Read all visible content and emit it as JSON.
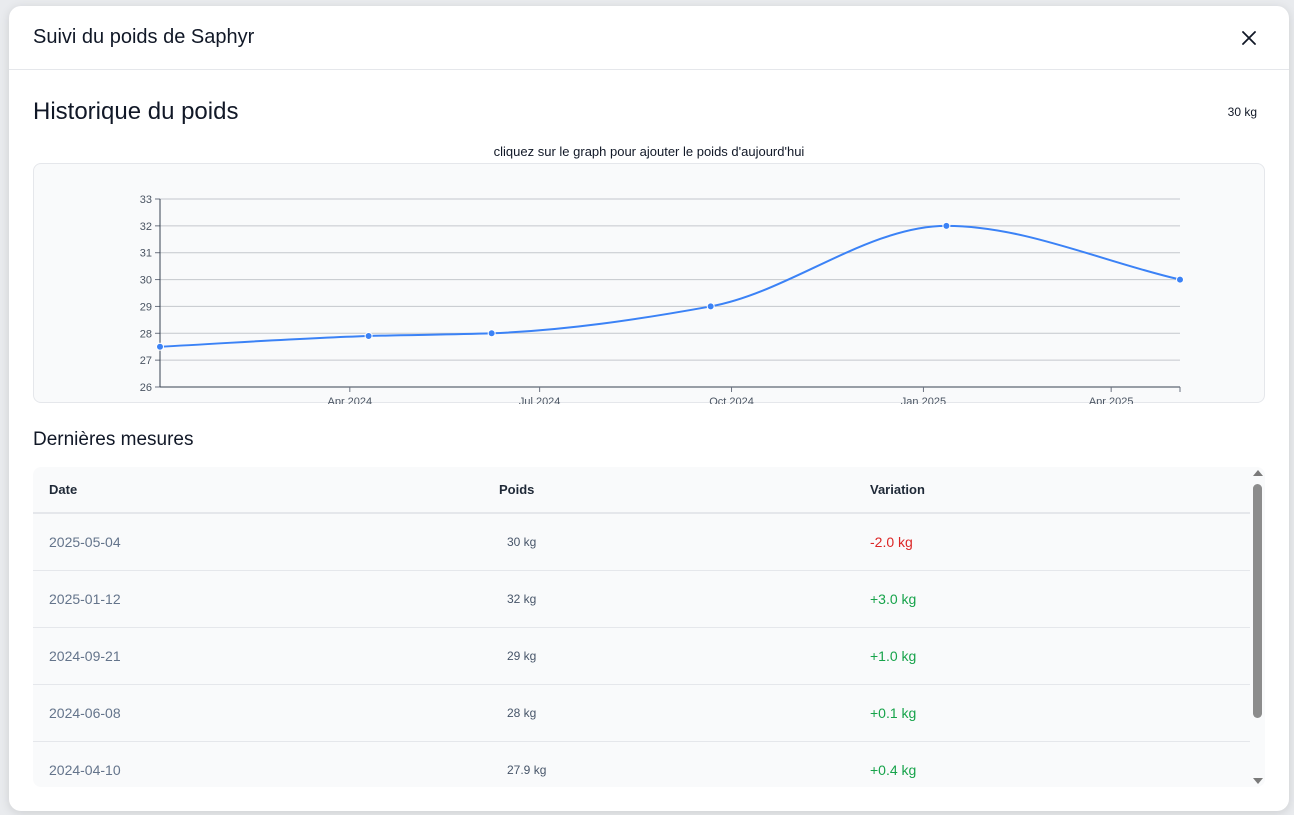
{
  "modal": {
    "title": "Suivi du poids de Saphyr"
  },
  "section": {
    "title": "Historique du poids",
    "current_weight": "30 kg",
    "chart_hint": "cliquez sur le graph pour ajouter le poids d'aujourd'hui"
  },
  "chart_data": {
    "type": "line",
    "title": "",
    "xlabel": "",
    "ylabel": "",
    "ylim": [
      26,
      33
    ],
    "xlim": [
      "2024-01-01",
      "2025-05-04"
    ],
    "yticks": [
      26,
      27,
      28,
      29,
      30,
      31,
      32,
      33
    ],
    "xticks": [
      {
        "label": "Apr 2024",
        "date": "2024-04-01"
      },
      {
        "label": "Jul 2024",
        "date": "2024-07-01"
      },
      {
        "label": "Oct 2024",
        "date": "2024-10-01"
      },
      {
        "label": "Jan 2025",
        "date": "2025-01-01"
      },
      {
        "label": "Apr 2025",
        "date": "2025-04-01"
      }
    ],
    "grid": true,
    "line_color": "#3b82f6",
    "series": [
      {
        "points": [
          {
            "x": "2024-01-01",
            "y": 27.5
          },
          {
            "x": "2024-04-10",
            "y": 27.9
          },
          {
            "x": "2024-06-08",
            "y": 28
          },
          {
            "x": "2024-09-21",
            "y": 29
          },
          {
            "x": "2025-01-12",
            "y": 32
          },
          {
            "x": "2025-05-04",
            "y": 30
          }
        ]
      }
    ]
  },
  "measures": {
    "title": "Dernières mesures",
    "columns": [
      "Date",
      "Poids",
      "Variation"
    ],
    "rows": [
      {
        "date": "2025-05-04",
        "poids": "30 kg",
        "variation": "-2.0 kg",
        "trend": "neg"
      },
      {
        "date": "2025-01-12",
        "poids": "32 kg",
        "variation": "+3.0 kg",
        "trend": "pos"
      },
      {
        "date": "2024-09-21",
        "poids": "29 kg",
        "variation": "+1.0 kg",
        "trend": "pos"
      },
      {
        "date": "2024-06-08",
        "poids": "28 kg",
        "variation": "+0.1 kg",
        "trend": "pos"
      },
      {
        "date": "2024-04-10",
        "poids": "27.9 kg",
        "variation": "+0.4 kg",
        "trend": "pos"
      }
    ]
  },
  "colors": {
    "negative": "#dc2626",
    "positive": "#16a34a",
    "line": "#3b82f6"
  },
  "icons": {
    "close": "close-icon"
  }
}
